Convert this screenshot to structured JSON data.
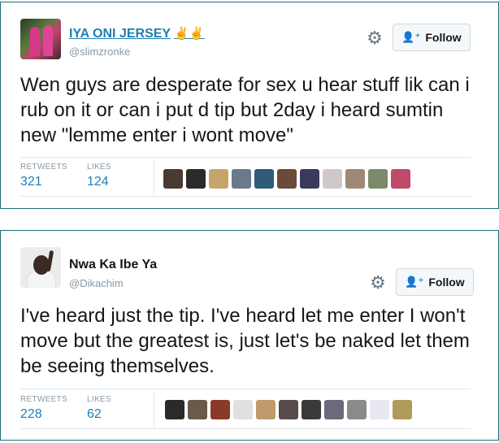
{
  "tweets": [
    {
      "name": "IYA ONI JERSEY",
      "name_emoji": "✌✌",
      "handle": "@slimzronke",
      "follow_label": "Follow",
      "text": "Wen guys are desperate for sex u hear stuff lik can i rub on it or can i put d tip but 2day i heard sumtin new \"lemme enter i wont move\"",
      "retweets_label": "RETWEETS",
      "retweets": "321",
      "likes_label": "LIKES",
      "likes": "124",
      "liker_avatar_colors": [
        "#4a3a32",
        "#2a2a2a",
        "#c7a56a",
        "#6b7a8a",
        "#2e5c7a",
        "#6a4a3a",
        "#3a3a5a",
        "#d0c8c8",
        "#a08878",
        "#7a8a6a",
        "#c04a6a"
      ]
    },
    {
      "name": "Nwa Ka Ibe Ya",
      "handle": "@Dikachim",
      "follow_label": "Follow",
      "text": "I've heard just the tip. I've heard let me enter I won't move but the greatest is, just let's be naked let them be seeing themselves.",
      "retweets_label": "RETWEETS",
      "retweets": "228",
      "likes_label": "LIKES",
      "likes": "62",
      "liker_avatar_colors": [
        "#2a2a2a",
        "#6a5a4a",
        "#8a3a2a",
        "#e0e0e0",
        "#c09a6a",
        "#5a4a4a",
        "#3a3a3a",
        "#6a6a7a",
        "#8a8a8a",
        "#e8e8f0",
        "#b09a5a"
      ]
    }
  ],
  "accent_color": "#1e7fb5"
}
